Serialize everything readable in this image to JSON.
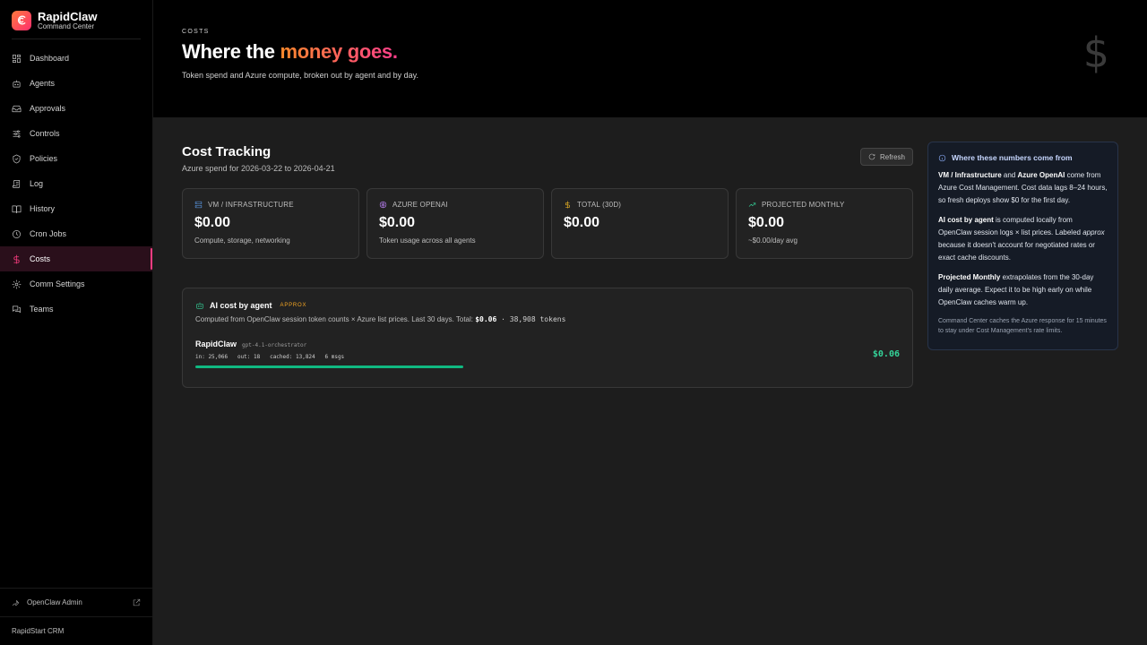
{
  "brand": {
    "name": "RapidClaw",
    "subtitle": "Command Center"
  },
  "nav": [
    {
      "label": "Dashboard",
      "icon": "grid-icon"
    },
    {
      "label": "Agents",
      "icon": "robot-icon"
    },
    {
      "label": "Approvals",
      "icon": "inbox-icon"
    },
    {
      "label": "Controls",
      "icon": "sliders-icon"
    },
    {
      "label": "Policies",
      "icon": "shield-icon"
    },
    {
      "label": "Log",
      "icon": "scroll-icon"
    },
    {
      "label": "History",
      "icon": "book-icon"
    },
    {
      "label": "Cron Jobs",
      "icon": "clock-icon"
    },
    {
      "label": "Costs",
      "icon": "dollar-icon",
      "active": true
    },
    {
      "label": "Comm Settings",
      "icon": "gear-icon"
    },
    {
      "label": "Teams",
      "icon": "chat-icon"
    }
  ],
  "sidebar_footer": {
    "admin_label": "OpenClaw Admin",
    "crm_label": "RapidStart CRM"
  },
  "hero": {
    "eyebrow": "COSTS",
    "title_plain": "Where the ",
    "title_accent": "money goes.",
    "subtitle": "Token spend and Azure compute, broken out by agent and by day.",
    "icon_glyph": "$"
  },
  "section": {
    "title": "Cost Tracking",
    "subtitle": "Azure spend for 2026-03-22 to 2026-04-21",
    "refresh_label": "Refresh"
  },
  "cards": [
    {
      "label": "VM / INFRASTRUCTURE",
      "value": "$0.00",
      "desc": "Compute, storage, networking",
      "icon": "server-icon",
      "color": "#60a5fa"
    },
    {
      "label": "AZURE OPENAI",
      "value": "$0.00",
      "desc": "Token usage across all agents",
      "icon": "brain-icon",
      "color": "#c084fc"
    },
    {
      "label": "TOTAL (30D)",
      "value": "$0.00",
      "desc": "",
      "icon": "dollar-icon",
      "color": "#fbbf24"
    },
    {
      "label": "PROJECTED MONTHLY",
      "value": "$0.00",
      "desc": "~$0.00/day avg",
      "icon": "trend-up-icon",
      "color": "#34d399"
    }
  ],
  "agent_panel": {
    "title": "AI cost by agent",
    "badge": "APPROX",
    "note_prefix": "Computed from OpenClaw session token counts × Azure list prices. Last 30 days. Total: ",
    "note_total": "$0.06",
    "note_tokens": " · 38,908 tokens",
    "agents": [
      {
        "name": "RapidClaw",
        "model": "gpt-4.1-orchestrator",
        "stats": "in: 25,066   out: 18   cached: 13,824   6 msgs",
        "cost": "$0.06",
        "share_percent": 100
      }
    ]
  },
  "info": {
    "title": "Where these numbers come from",
    "p1_b1": "VM / Infrastructure",
    "p1_and": " and ",
    "p1_b2": "Azure OpenAI",
    "p1_rest": " come from Azure Cost Management. Cost data lags 8–24 hours, so fresh deploys show $0 for the first day.",
    "p2_b": "AI cost by agent",
    "p2_rest1": " is computed locally from OpenClaw session logs × list prices. Labeled ",
    "p2_em": "approx",
    "p2_rest2": " because it doesn't account for negotiated rates or exact cache discounts.",
    "p3_b": "Projected Monthly",
    "p3_rest": " extrapolates from the 30-day daily average. Expect it to be high early on while OpenClaw caches warm up.",
    "foot": "Command Center caches the Azure response for 15 minutes to stay under Cost Management's rate limits."
  }
}
